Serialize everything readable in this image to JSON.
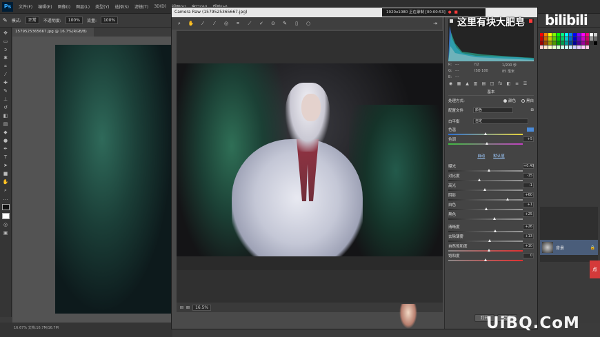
{
  "app": {
    "logo": "Ps",
    "menus": [
      "文件(F)",
      "编辑(E)",
      "图像(I)",
      "图层(L)",
      "类型(Y)",
      "选择(S)",
      "滤镜(T)",
      "3D(D)",
      "视图(V)",
      "窗口(W)",
      "帮助(H)"
    ]
  },
  "options_bar": {
    "mode_label": "模式:",
    "mode_value": "正常",
    "opacity_label": "不透明度:",
    "opacity_value": "100%",
    "flow_label": "流量:",
    "flow_value": "100%"
  },
  "document": {
    "tab_title": "1579525365667.jpg @ 16.7%(RGB/8)",
    "status": "16.67%   文档:16.7M/16.7M"
  },
  "camera_raw": {
    "title": "Camera Raw (1579525365667.jpg)",
    "recording": "1920x1080  正在录制 [00:00:53]",
    "zoom": "16.5%",
    "readout": {
      "r_label": "R:",
      "r_value": "---",
      "g_label": "G:",
      "g_value": "---",
      "b_label": "B:",
      "b_value": "---",
      "aperture": "f/2",
      "shutter": "1/200 秒",
      "iso": "ISO 100",
      "focal": "85 毫米"
    },
    "panel_title": "基本",
    "treatment_label": "处理方式:",
    "treatment_color": "颜色",
    "treatment_bw": "黑白",
    "profile_label": "配置文件",
    "profile_value": "颜色",
    "wb_label": "白平衡",
    "wb_value": "自定",
    "auto_label": "自动",
    "default_label": "默认值",
    "sliders": [
      {
        "label": "色温",
        "value": "",
        "level": 0.5
      },
      {
        "label": "色调",
        "value": "+5",
        "level": 0.52
      },
      {
        "label": "曝光",
        "value": "+0.40",
        "level": 0.55
      },
      {
        "label": "对比度",
        "value": "-15",
        "level": 0.42
      },
      {
        "label": "高光",
        "value": "-1",
        "level": 0.49
      },
      {
        "label": "阴影",
        "value": "+60",
        "level": 0.8
      },
      {
        "label": "白色",
        "value": "+1",
        "level": 0.51
      },
      {
        "label": "黑色",
        "value": "+25",
        "level": 0.62
      },
      {
        "label": "清晰度",
        "value": "+26",
        "level": 0.63
      },
      {
        "label": "去除薄雾",
        "value": "+13",
        "level": 0.56
      },
      {
        "label": "自然饱和度",
        "value": "+10",
        "level": 0.55
      },
      {
        "label": "饱和度",
        "value": "0",
        "level": 0.5
      }
    ],
    "buttons": {
      "open": "打开",
      "done": "完成"
    }
  },
  "layers": {
    "layer_name": "背景"
  },
  "overlay": {
    "caption": "这里有块大肥皂",
    "brand": "bilibili",
    "watermark": "UiBQ.CoM",
    "pin": "点"
  },
  "colors": {
    "swatches": [
      "#ff0000",
      "#ff8000",
      "#ffff00",
      "#80ff00",
      "#00ff00",
      "#00ff80",
      "#00ffff",
      "#0080ff",
      "#0000ff",
      "#8000ff",
      "#ff00ff",
      "#ff0080",
      "#ffffff",
      "#cccccc",
      "#cc0000",
      "#cc6600",
      "#cccc00",
      "#66cc00",
      "#00cc00",
      "#00cc66",
      "#00cccc",
      "#0066cc",
      "#0000cc",
      "#6600cc",
      "#cc00cc",
      "#cc0066",
      "#999999",
      "#666666",
      "#990000",
      "#994c00",
      "#999900",
      "#4c9900",
      "#009900",
      "#00994c",
      "#009999",
      "#004c99",
      "#000099",
      "#4c0099",
      "#990099",
      "#99004c",
      "#333333",
      "#000000",
      "#ffcccc",
      "#ffe5cc",
      "#ffffcc",
      "#e5ffcc",
      "#ccffcc",
      "#ccffe5",
      "#ccffff",
      "#cce5ff",
      "#ccccff",
      "#e5ccff",
      "#ffccff",
      "#ffcce5"
    ]
  }
}
